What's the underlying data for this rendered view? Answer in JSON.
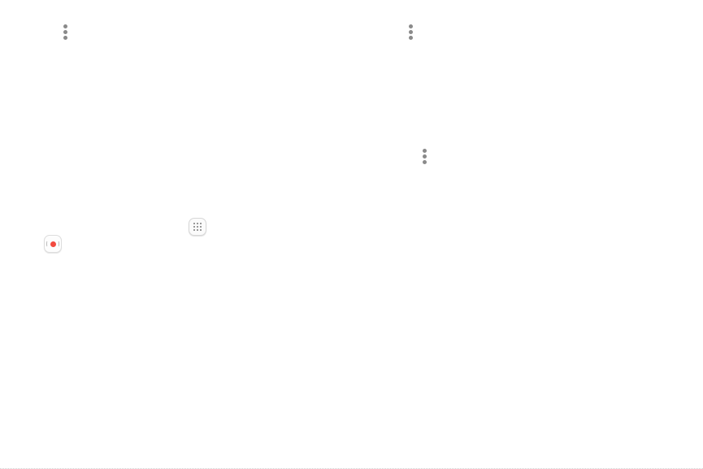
{
  "icons": {
    "more_options_1": "more-vertical-icon",
    "more_options_2": "more-vertical-icon",
    "more_options_3": "more-vertical-icon",
    "apps": "apps-grid-icon",
    "voice_recorder": "voice-recorder-icon"
  },
  "colors": {
    "icon_gray": "#8a8a8a",
    "record_red": "#f24a3f"
  }
}
